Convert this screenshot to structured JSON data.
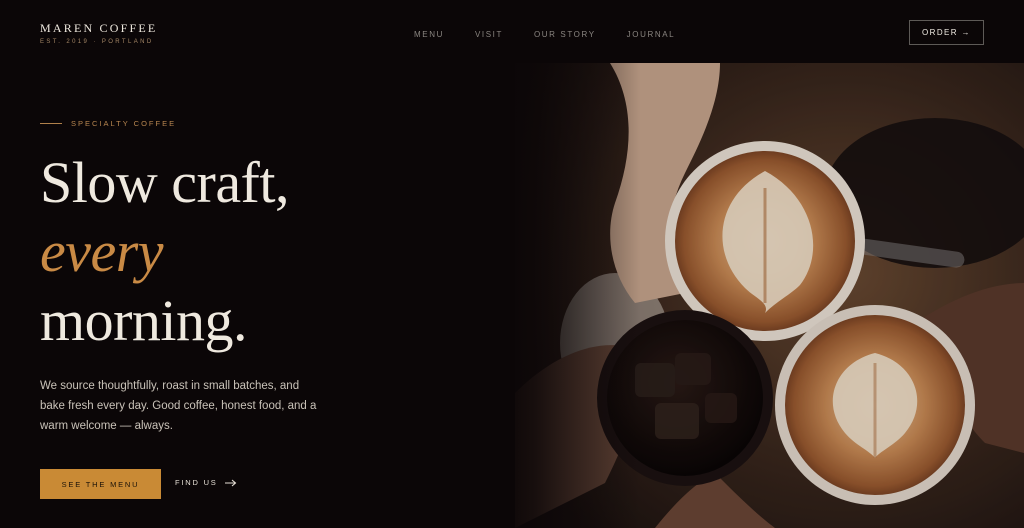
{
  "brand": {
    "name": "MAREN COFFEE",
    "tagline": "EST. 2019 · PORTLAND"
  },
  "nav": {
    "items": [
      {
        "label": "MENU"
      },
      {
        "label": "VISIT"
      },
      {
        "label": "OUR STORY"
      },
      {
        "label": "JOURNAL"
      }
    ]
  },
  "header": {
    "order_label": "ORDER →"
  },
  "hero": {
    "eyebrow": "SPECIALTY COFFEE",
    "headline_line1": "Slow craft,",
    "headline_accent": "every",
    "headline_line3": "morning.",
    "body": "We source thoughtfully, roast in small batches, and bake fresh every day. Good coffee, honest food, and a warm welcome — always.",
    "primary_cta": "SEE THE MENU",
    "secondary_cta": "FIND US"
  },
  "colors": {
    "background": "#0b0607",
    "accent": "#c98a35",
    "text": "#efe9df"
  },
  "icons": {
    "secondary_cta": "arrow-right-icon"
  }
}
